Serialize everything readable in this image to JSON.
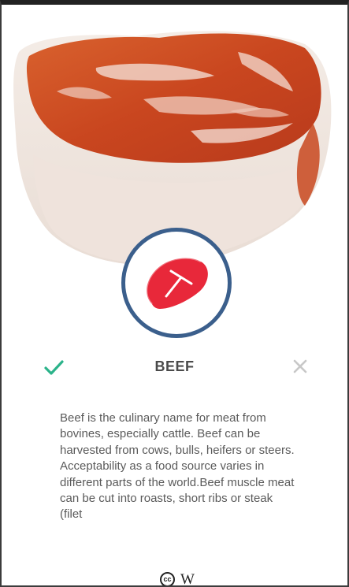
{
  "card": {
    "title": "BEEF",
    "description": "Beef is the culinary name for meat from bovines, especially cattle. Beef can be harvested from cows, bulls, heifers or steers. Acceptability as a food source varies in different parts of the world.Beef muscle meat can be cut into roasts, short ribs or steak (filet",
    "accept_icon": "checkmark-icon",
    "reject_icon": "close-icon",
    "badge_icon": "steak-icon"
  },
  "footer": {
    "license_label": "cc",
    "source_label": "W"
  },
  "colors": {
    "accept": "#2bb38a",
    "reject": "#c8c8c8",
    "badge_ring": "#3b5f8c",
    "badge_steak": "#e8283a",
    "text": "#5a5a5a",
    "title": "#4a4a4a"
  }
}
